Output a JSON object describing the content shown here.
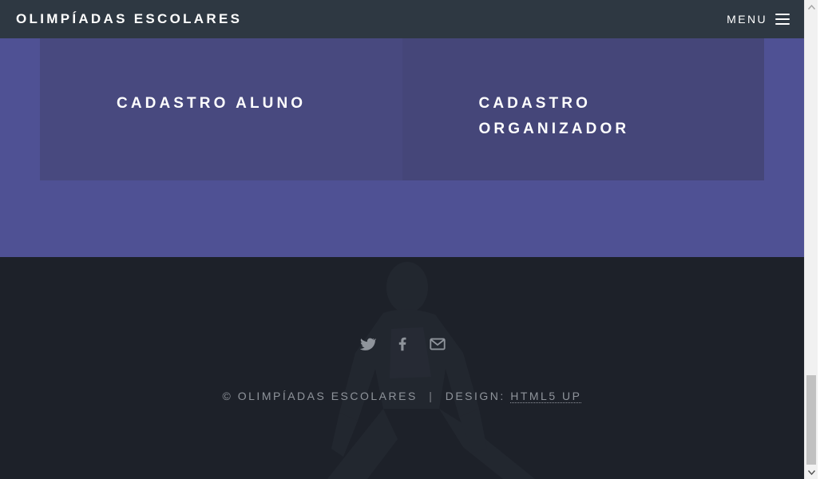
{
  "header": {
    "brand": "OLIMPÍADAS ESCOLARES",
    "menu_label": "MENU"
  },
  "cards": [
    {
      "label": "CADASTRO ALUNO"
    },
    {
      "label": "CADASTRO ORGANIZADOR"
    }
  ],
  "footer": {
    "icons": [
      "twitter-icon",
      "facebook-icon",
      "envelope-icon"
    ],
    "copyright": "© OLIMPÍADAS ESCOLARES",
    "separator": "|",
    "design_prefix": "DESIGN:",
    "design_link": "HTML5 UP"
  },
  "colors": {
    "header_bg": "#2e3842",
    "section_bg": "#4f5194",
    "card_bg": "#48497f",
    "footer_bg": "#1d2129"
  }
}
